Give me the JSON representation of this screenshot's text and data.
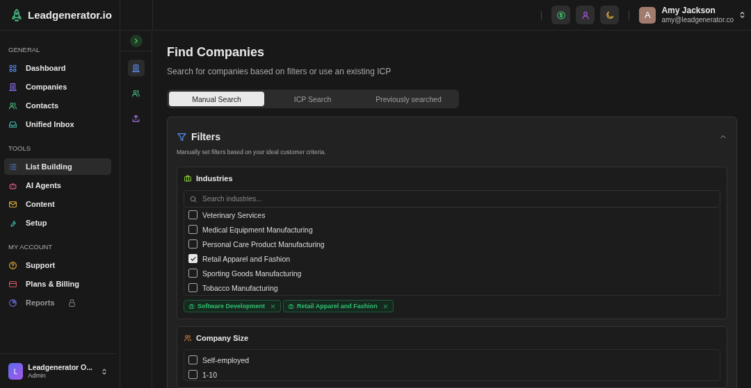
{
  "brand": {
    "name": "Leadgenerator.io"
  },
  "sidebar": {
    "sections": [
      {
        "title": "GENERAL",
        "items": [
          {
            "label": "Dashboard",
            "selected": false,
            "locked": false
          },
          {
            "label": "Companies",
            "selected": false,
            "locked": false
          },
          {
            "label": "Contacts",
            "selected": false,
            "locked": false
          },
          {
            "label": "Unified Inbox",
            "selected": false,
            "locked": false
          }
        ]
      },
      {
        "title": "TOOLS",
        "items": [
          {
            "label": "List Building",
            "selected": true,
            "locked": false
          },
          {
            "label": "AI Agents",
            "selected": false,
            "locked": false
          },
          {
            "label": "Content",
            "selected": false,
            "locked": false
          },
          {
            "label": "Setup",
            "selected": false,
            "locked": false
          }
        ]
      },
      {
        "title": "MY ACCOUNT",
        "items": [
          {
            "label": "Support",
            "selected": false,
            "locked": false
          },
          {
            "label": "Plans & Billing",
            "selected": false,
            "locked": false
          },
          {
            "label": "Reports",
            "selected": false,
            "locked": true
          }
        ]
      }
    ],
    "org": {
      "initial": "L",
      "name": "Leadgenerator O...",
      "role": "Admin"
    }
  },
  "rail": {
    "items": [
      {
        "selected": true
      },
      {
        "selected": false
      },
      {
        "selected": false
      }
    ]
  },
  "header": {
    "user": {
      "initial": "A",
      "name": "Amy Jackson",
      "email": "amy@leadgenerator.co"
    }
  },
  "page": {
    "title": "Find Companies",
    "subtitle": "Search for companies based on filters or use an existing ICP"
  },
  "tabs": [
    {
      "label": "Manual Search",
      "selected": true
    },
    {
      "label": "ICP Search",
      "selected": false
    },
    {
      "label": "Previously searched",
      "selected": false
    }
  ],
  "filters": {
    "title": "Filters",
    "description": "Manually set filters based on your ideal customer criteria.",
    "expanded": true,
    "industries": {
      "title": "Industries",
      "search_placeholder": "Search industries...",
      "options": [
        {
          "label": "Veterinary Services",
          "checked": false
        },
        {
          "label": "Medical Equipment Manufacturing",
          "checked": false
        },
        {
          "label": "Personal Care Product Manufacturing",
          "checked": false
        },
        {
          "label": "Retail Apparel and Fashion",
          "checked": true
        },
        {
          "label": "Sporting Goods Manufacturing",
          "checked": false
        },
        {
          "label": "Tobacco Manufacturing",
          "checked": false
        }
      ],
      "tags": [
        "Software Development",
        "Retail Apparel and Fashion"
      ]
    },
    "company_size": {
      "title": "Company Size",
      "options": [
        {
          "label": "Self-employed",
          "checked": false
        },
        {
          "label": "1-10",
          "checked": false
        }
      ]
    }
  }
}
